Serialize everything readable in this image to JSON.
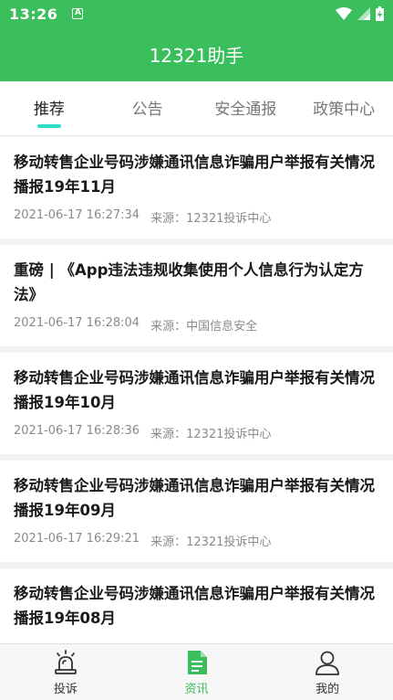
{
  "status_bar": {
    "time": "13:26",
    "notification_glyph": "A",
    "icons": [
      "wifi-icon",
      "signal-icon",
      "battery-icon"
    ]
  },
  "app_bar": {
    "title": "12321助手"
  },
  "tabs": [
    {
      "label": "推荐",
      "active": true
    },
    {
      "label": "公告",
      "active": false
    },
    {
      "label": "安全通报",
      "active": false
    },
    {
      "label": "政策中心",
      "active": false
    }
  ],
  "news": [
    {
      "title": "移动转售企业号码涉嫌通讯信息诈骗用户举报有关情况播报19年11月",
      "time": "2021-06-17 16:27:34",
      "source": "来源：12321投诉中心"
    },
    {
      "title": "重磅 | 《App违法违规收集使用个人信息行为认定方法》",
      "time": "2021-06-17 16:28:04",
      "source": "来源：中国信息安全"
    },
    {
      "title": "移动转售企业号码涉嫌通讯信息诈骗用户举报有关情况播报19年10月",
      "time": "2021-06-17 16:28:36",
      "source": "来源：12321投诉中心"
    },
    {
      "title": "移动转售企业号码涉嫌通讯信息诈骗用户举报有关情况播报19年09月",
      "time": "2021-06-17 16:29:21",
      "source": "来源：12321投诉中心"
    },
    {
      "title": "移动转售企业号码涉嫌通讯信息诈骗用户举报有关情况播报19年08月",
      "time": "",
      "source": ""
    }
  ],
  "bottom_nav": [
    {
      "label": "投诉",
      "icon": "alarm-siren-icon",
      "active": false
    },
    {
      "label": "资讯",
      "icon": "document-icon",
      "active": true
    },
    {
      "label": "我的",
      "icon": "person-icon",
      "active": false
    }
  ],
  "colors": {
    "primary": "#3bbf5c",
    "tab_indicator": "#2ee0c8"
  }
}
